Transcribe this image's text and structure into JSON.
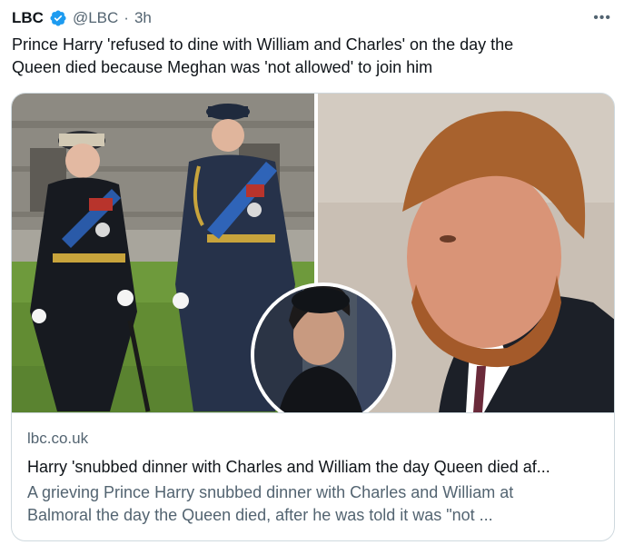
{
  "tweet": {
    "author_name": "LBC",
    "handle": "@LBC",
    "separator": "·",
    "time": "3h",
    "more_icon": "more-horizontal-icon",
    "text_line1": "Prince Harry 'refused to dine with William and Charles' on the day the",
    "text_line2": "Queen died because Meghan was 'not allowed' to join him"
  },
  "card": {
    "domain": "lbc.co.uk",
    "title": "Harry 'snubbed dinner with Charles and William the day Queen died af...",
    "description_line1": "A grieving Prince Harry snubbed dinner with Charles and William at",
    "description_line2": "Balmoral the day the Queen died, after he was told it was \"not ..."
  },
  "colors": {
    "verified": "#1d9bf0",
    "muted": "#536471",
    "border": "#cfd9de"
  }
}
